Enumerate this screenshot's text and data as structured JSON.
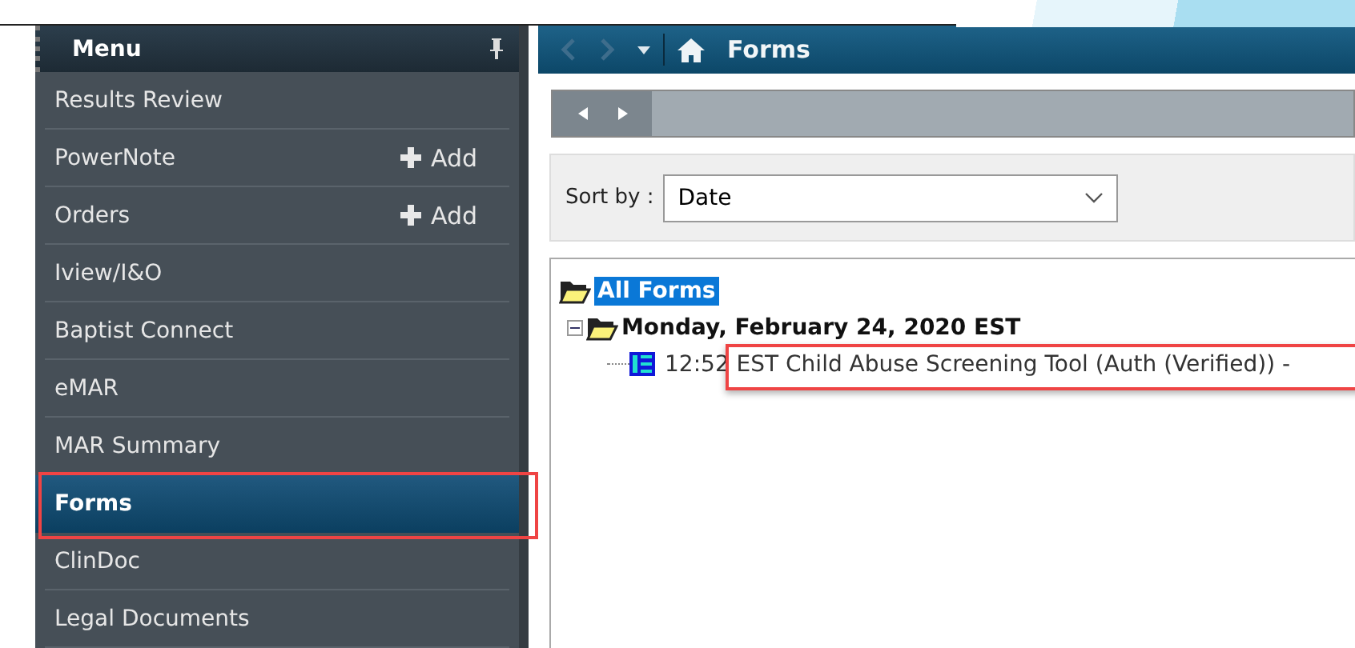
{
  "menu": {
    "title": "Menu",
    "items": [
      {
        "label": "Results Review",
        "selected": false
      },
      {
        "label": "PowerNote",
        "selected": false,
        "action": "Add"
      },
      {
        "label": "Orders",
        "selected": false,
        "action": "Add"
      },
      {
        "label": "Iview/I&O",
        "selected": false
      },
      {
        "label": "Baptist Connect",
        "selected": false
      },
      {
        "label": "eMAR",
        "selected": false
      },
      {
        "label": "MAR Summary",
        "selected": false
      },
      {
        "label": "Forms",
        "selected": true,
        "highlighted": true
      },
      {
        "label": "ClinDoc",
        "selected": false
      },
      {
        "label": "Legal Documents",
        "selected": false
      }
    ]
  },
  "header": {
    "title": "Forms"
  },
  "sort": {
    "label": "Sort by :",
    "value": "Date"
  },
  "tree": {
    "root": {
      "label": "All Forms",
      "selected": true,
      "children": [
        {
          "label": "Monday, February 24, 2020 EST",
          "expanded": true,
          "children": [
            {
              "time": "12:52",
              "label": "EST Child Abuse Screening Tool (Auth (Verified)) -",
              "highlighted": true
            }
          ]
        }
      ]
    }
  }
}
